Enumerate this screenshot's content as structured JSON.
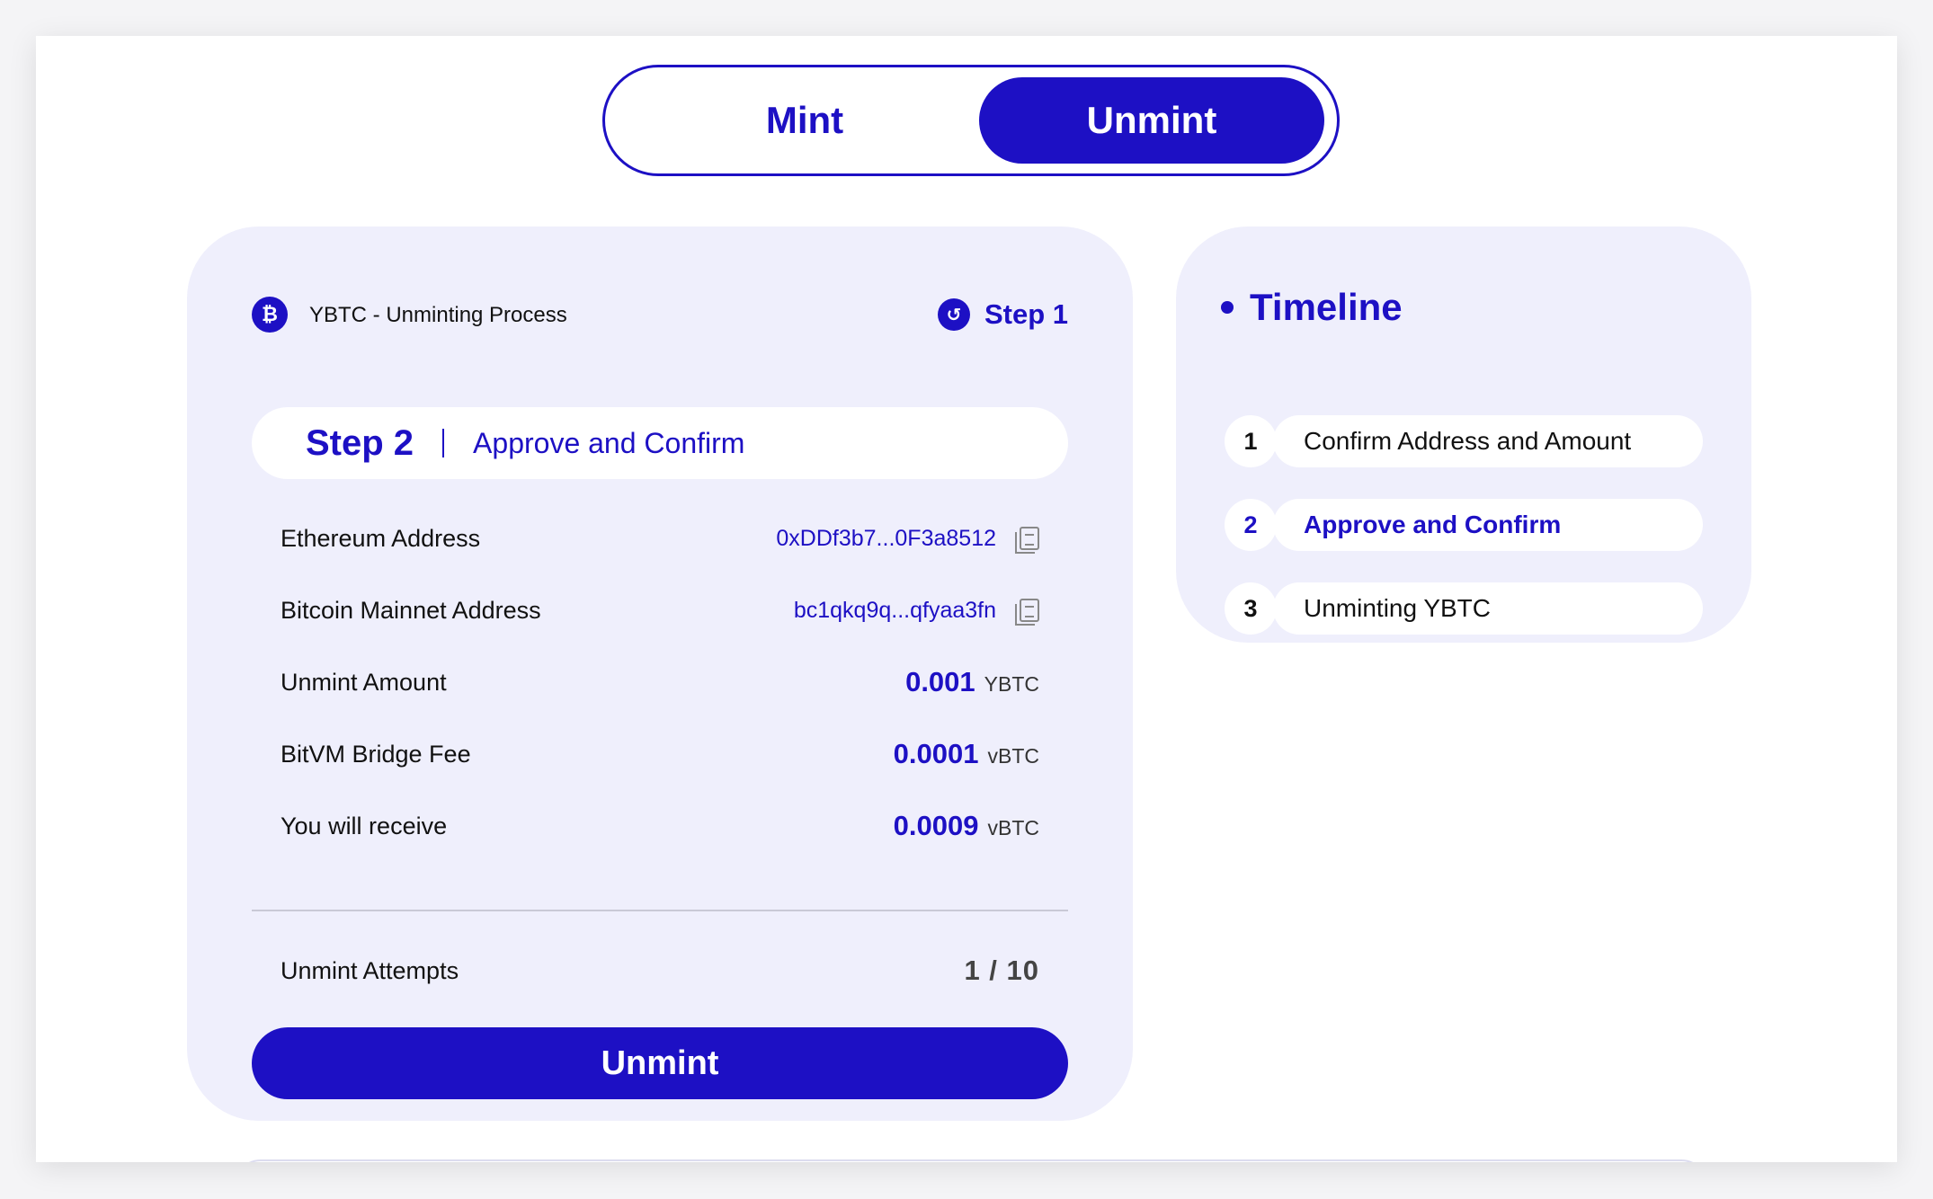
{
  "toggle": {
    "mint_label": "Mint",
    "unmint_label": "Unmint",
    "selected": "Unmint"
  },
  "process": {
    "title": "YBTC - Unminting Process",
    "coin_icon": "bitcoin-icon",
    "back_step_label": "Step 1",
    "back_icon": "back-arrow-icon"
  },
  "step": {
    "number": "Step 2",
    "name": "Approve and Confirm"
  },
  "details": [
    {
      "label": "Ethereum Address",
      "value": "0xDDf3b7...0F3a8512",
      "copyable": true
    },
    {
      "label": "Bitcoin Mainnet Address",
      "value": "bc1qkq9q...qfyaa3fn",
      "copyable": true
    },
    {
      "label": "Unmint Amount",
      "value": "0.001",
      "unit": "YBTC"
    },
    {
      "label": "BitVM Bridge Fee",
      "value": "0.0001",
      "unit": "vBTC"
    },
    {
      "label": "You will receive",
      "value": "0.0009",
      "unit": "vBTC"
    }
  ],
  "attempts": {
    "label": "Unmint Attempts",
    "value": "1 / 10"
  },
  "action_button": {
    "label": "Unmint"
  },
  "timeline": {
    "title": "Timeline",
    "items": [
      {
        "num": "1",
        "label": "Confirm Address and Amount",
        "active": false
      },
      {
        "num": "2",
        "label": "Approve and Confirm",
        "active": true
      },
      {
        "num": "3",
        "label": "Unminting YBTC",
        "active": false
      }
    ]
  },
  "colors": {
    "accent": "#1d10c4",
    "card_bg": "#efeffc",
    "page_bg": "#ffffff"
  }
}
